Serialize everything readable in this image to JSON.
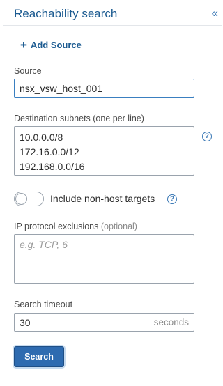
{
  "panel": {
    "title": "Reachability search",
    "collapse_icon": "«"
  },
  "add_source": {
    "icon": "+",
    "label": "Add Source"
  },
  "source": {
    "label": "Source",
    "value": "nsx_vsw_host_001"
  },
  "destinations": {
    "label": "Destination subnets (one per line)",
    "lines": [
      "10.0.0.0/8",
      "172.16.0.0/12",
      "192.168.0.0/16"
    ],
    "help_icon": "?"
  },
  "non_host": {
    "label": "Include non-host targets",
    "enabled": false,
    "help_icon": "?"
  },
  "protocol_exclusions": {
    "label": "IP protocol exclusions",
    "optional": "(optional)",
    "placeholder": "e.g. TCP, 6"
  },
  "timeout": {
    "label": "Search timeout",
    "value": "30",
    "unit": "seconds"
  },
  "search_button": {
    "label": "Search"
  }
}
